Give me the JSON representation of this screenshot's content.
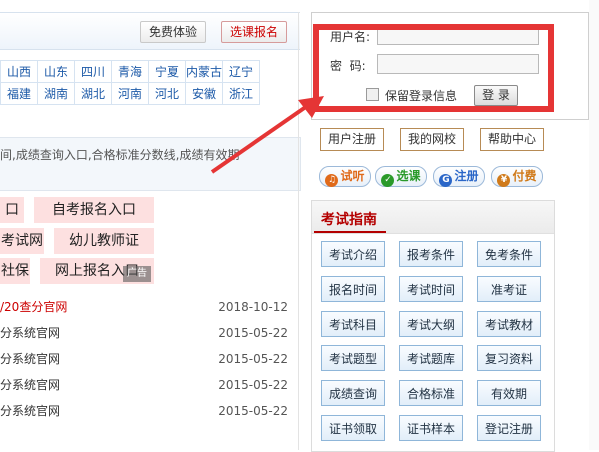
{
  "header": {
    "trial_label": "免费体验",
    "signup_label": "选课报名"
  },
  "regions": [
    [
      "山西",
      "山东",
      "四川",
      "青海",
      "宁夏",
      "内蒙古",
      "辽宁"
    ],
    [
      "福建",
      "湖南",
      "湖北",
      "河南",
      "河北",
      "安徽",
      "浙江"
    ]
  ],
  "info_text": "间,成绩查询入口,合格标准分数线,成绩有效期",
  "promo_links": [
    "口",
    "自考报名入口",
    "考试网",
    "幼儿教师证",
    "社保",
    "网上报名入口"
  ],
  "ad_label": "广告",
  "news": [
    {
      "title": "/20查分官网",
      "date": "2018-10-12",
      "highlight": true
    },
    {
      "title": "分系统官网",
      "date": "2015-05-22",
      "highlight": false
    },
    {
      "title": "分系统官网",
      "date": "2015-05-22",
      "highlight": false
    },
    {
      "title": "分系统官网",
      "date": "2015-05-22",
      "highlight": false
    },
    {
      "title": "分系统官网",
      "date": "2015-05-22",
      "highlight": false
    }
  ],
  "login": {
    "username_label": "用户名:",
    "password_label": "密  码:",
    "username_value": "",
    "password_value": "",
    "remember_label": "保留登录信息",
    "login_button": "登 录"
  },
  "quick_links": [
    "用户注册",
    "我的网校",
    "帮助中心"
  ],
  "pills": [
    {
      "label": "试听",
      "icon": "headphones-icon",
      "color": "#e06a1a"
    },
    {
      "label": "选课",
      "icon": "check-icon",
      "color": "#2a9a2a"
    },
    {
      "label": "注册",
      "icon": "register-icon",
      "color": "#2a66c8"
    },
    {
      "label": "付费",
      "icon": "payment-icon",
      "color": "#d07a1a"
    }
  ],
  "guide": {
    "title": "考试指南",
    "buttons": [
      [
        "考试介绍",
        "报考条件",
        "免考条件"
      ],
      [
        "报名时间",
        "考试时间",
        "准考证"
      ],
      [
        "考试科目",
        "考试大纲",
        "考试教材"
      ],
      [
        "考试题型",
        "考试题库",
        "复习资料"
      ],
      [
        "成绩查询",
        "合格标准",
        "有效期"
      ],
      [
        "证书领取",
        "证书样本",
        "登记注册"
      ]
    ]
  },
  "colors": {
    "highlight_border": "#e53535",
    "link_blue": "#1d5aa8",
    "guide_red": "#b40000",
    "promo_pink": "#fde0e0"
  }
}
